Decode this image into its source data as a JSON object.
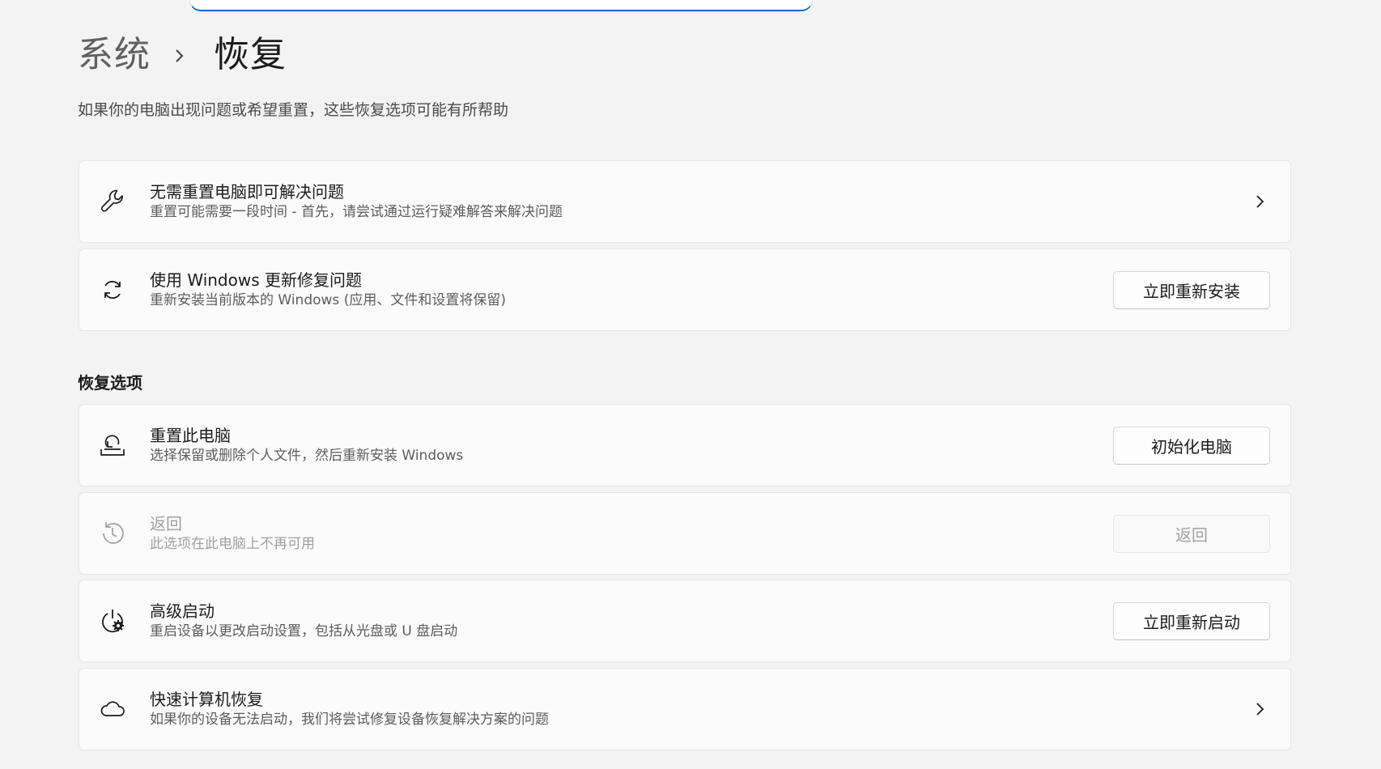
{
  "breadcrumb": {
    "parent": "系统",
    "separator_icon": "chevron-right-icon",
    "current": "恢复"
  },
  "subtitle": "如果你的电脑出现问题或希望重置，这些恢复选项可能有所帮助",
  "cards_top": [
    {
      "icon": "wrench-icon",
      "title": "无需重置电脑即可解决问题",
      "desc": "重置可能需要一段时间 - 首先，请尝试通过运行疑难解答来解决问题",
      "action": "chevron"
    },
    {
      "icon": "sync-icon",
      "title": "使用 Windows 更新修复问题",
      "desc": "重新安装当前版本的 Windows (应用、文件和设置将保留)",
      "action_label": "立即重新安装"
    }
  ],
  "recovery_options": {
    "section_title": "恢复选项",
    "items": [
      {
        "icon": "reset-pc-icon",
        "title": "重置此电脑",
        "desc": "选择保留或删除个人文件，然后重新安装 Windows",
        "action_label": "初始化电脑"
      },
      {
        "icon": "history-icon",
        "title": "返回",
        "desc": "此选项在此电脑上不再可用",
        "action_label": "返回",
        "disabled": true
      },
      {
        "icon": "advanced-startup-icon",
        "title": "高级启动",
        "desc": "重启设备以更改启动设置，包括从光盘或 U 盘启动",
        "action_label": "立即重新启动"
      },
      {
        "icon": "cloud-icon",
        "title": "快速计算机恢复",
        "desc": "如果你的设备无法启动，我们将尝试修复设备恢复解决方案的问题",
        "action": "chevron"
      }
    ]
  }
}
